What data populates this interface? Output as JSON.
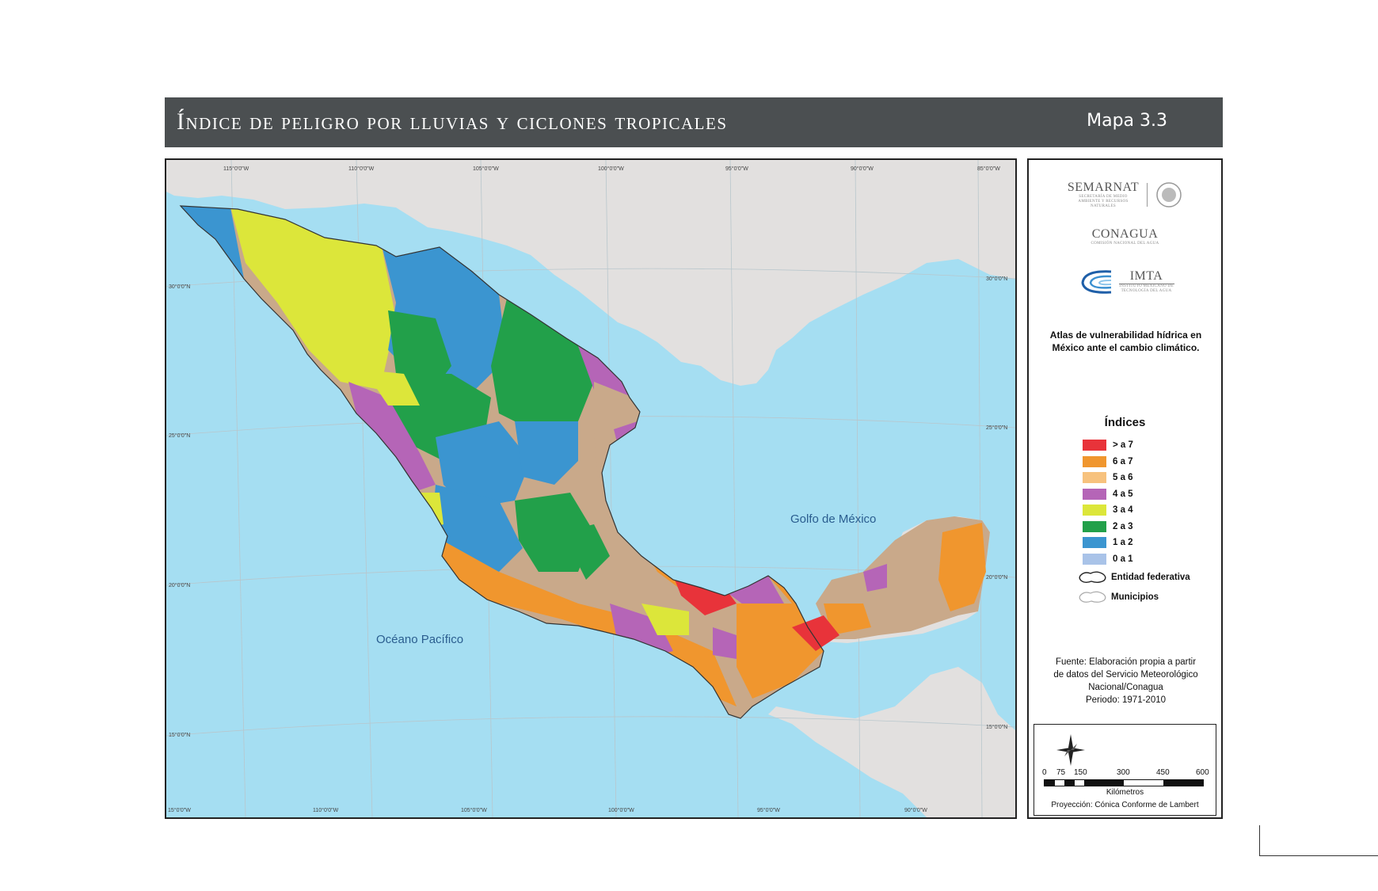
{
  "header": {
    "title": "Índice de peligro por lluvias y ciclones tropicales",
    "map_number": "Mapa 3.3"
  },
  "map": {
    "ocean_labels": [
      "Océano Pacífico",
      "Golfo de México"
    ],
    "top_longitude_ticks": [
      "115°0'0\"W",
      "110°0'0\"W",
      "105°0'0\"W",
      "100°0'0\"W",
      "95°0'0\"W",
      "90°0'0\"W",
      "85°0'0\"W"
    ],
    "bottom_longitude_ticks": [
      "15°0'0\"W",
      "110°0'0\"W",
      "105°0'0\"W",
      "100°0'0\"W",
      "95°0'0\"W",
      "90°0'0\"W"
    ],
    "left_latitude_ticks": [
      "30°0'0\"N",
      "25°0'0\"N",
      "20°0'0\"N",
      "15°0'0\"N"
    ],
    "right_latitude_ticks": [
      "30°0'0\"N",
      "25°0'0\"N",
      "20°0'0\"N",
      "15°0'0\"N"
    ],
    "colors": {
      "ocean": "#a5def2",
      "land_other": "#e2e0df"
    }
  },
  "logos": {
    "semarnat": {
      "name": "SEMARNAT",
      "sub": "SECRETARÍA DE MEDIO AMBIENTE Y RECURSOS NATURALES"
    },
    "conagua": {
      "name": "CONAGUA",
      "sub": "COMISIÓN NACIONAL DEL AGUA"
    },
    "imta": {
      "name": "IMTA",
      "sub": "INSTITUTO MEXICANO DE TECNOLOGÍA DEL AGUA"
    }
  },
  "atlas_title": "Atlas de vulnerabilidad hídrica en México ante el cambio climático.",
  "legend": {
    "title": "Índices",
    "items": [
      {
        "label": "> a 7",
        "color": "#e8333a"
      },
      {
        "label": "6 a 7",
        "color": "#f0962e"
      },
      {
        "label": "5 a 6",
        "color": "#f7c27e"
      },
      {
        "label": "4 a 5",
        "color": "#b565b7"
      },
      {
        "label": "3 a 4",
        "color": "#dce63a"
      },
      {
        "label": "2 a 3",
        "color": "#22a04a"
      },
      {
        "label": "1 a 2",
        "color": "#3b95d0"
      },
      {
        "label": "0 a 1",
        "color": "#a9c3e8"
      }
    ],
    "entidad_label": "Entidad federativa",
    "municipios_label": "Municipios"
  },
  "source": {
    "line1": "Fuente: Elaboración propia a partir",
    "line2": "de datos del Servicio Meteorológico",
    "line3": "Nacional/Conagua",
    "line4": "Periodo: 1971-2010"
  },
  "scale": {
    "ticks": [
      "0",
      "75",
      "150",
      "300",
      "450",
      "600"
    ],
    "unit": "Kilómetros",
    "projection": "Proyección: Cónica Conforme de Lambert"
  }
}
